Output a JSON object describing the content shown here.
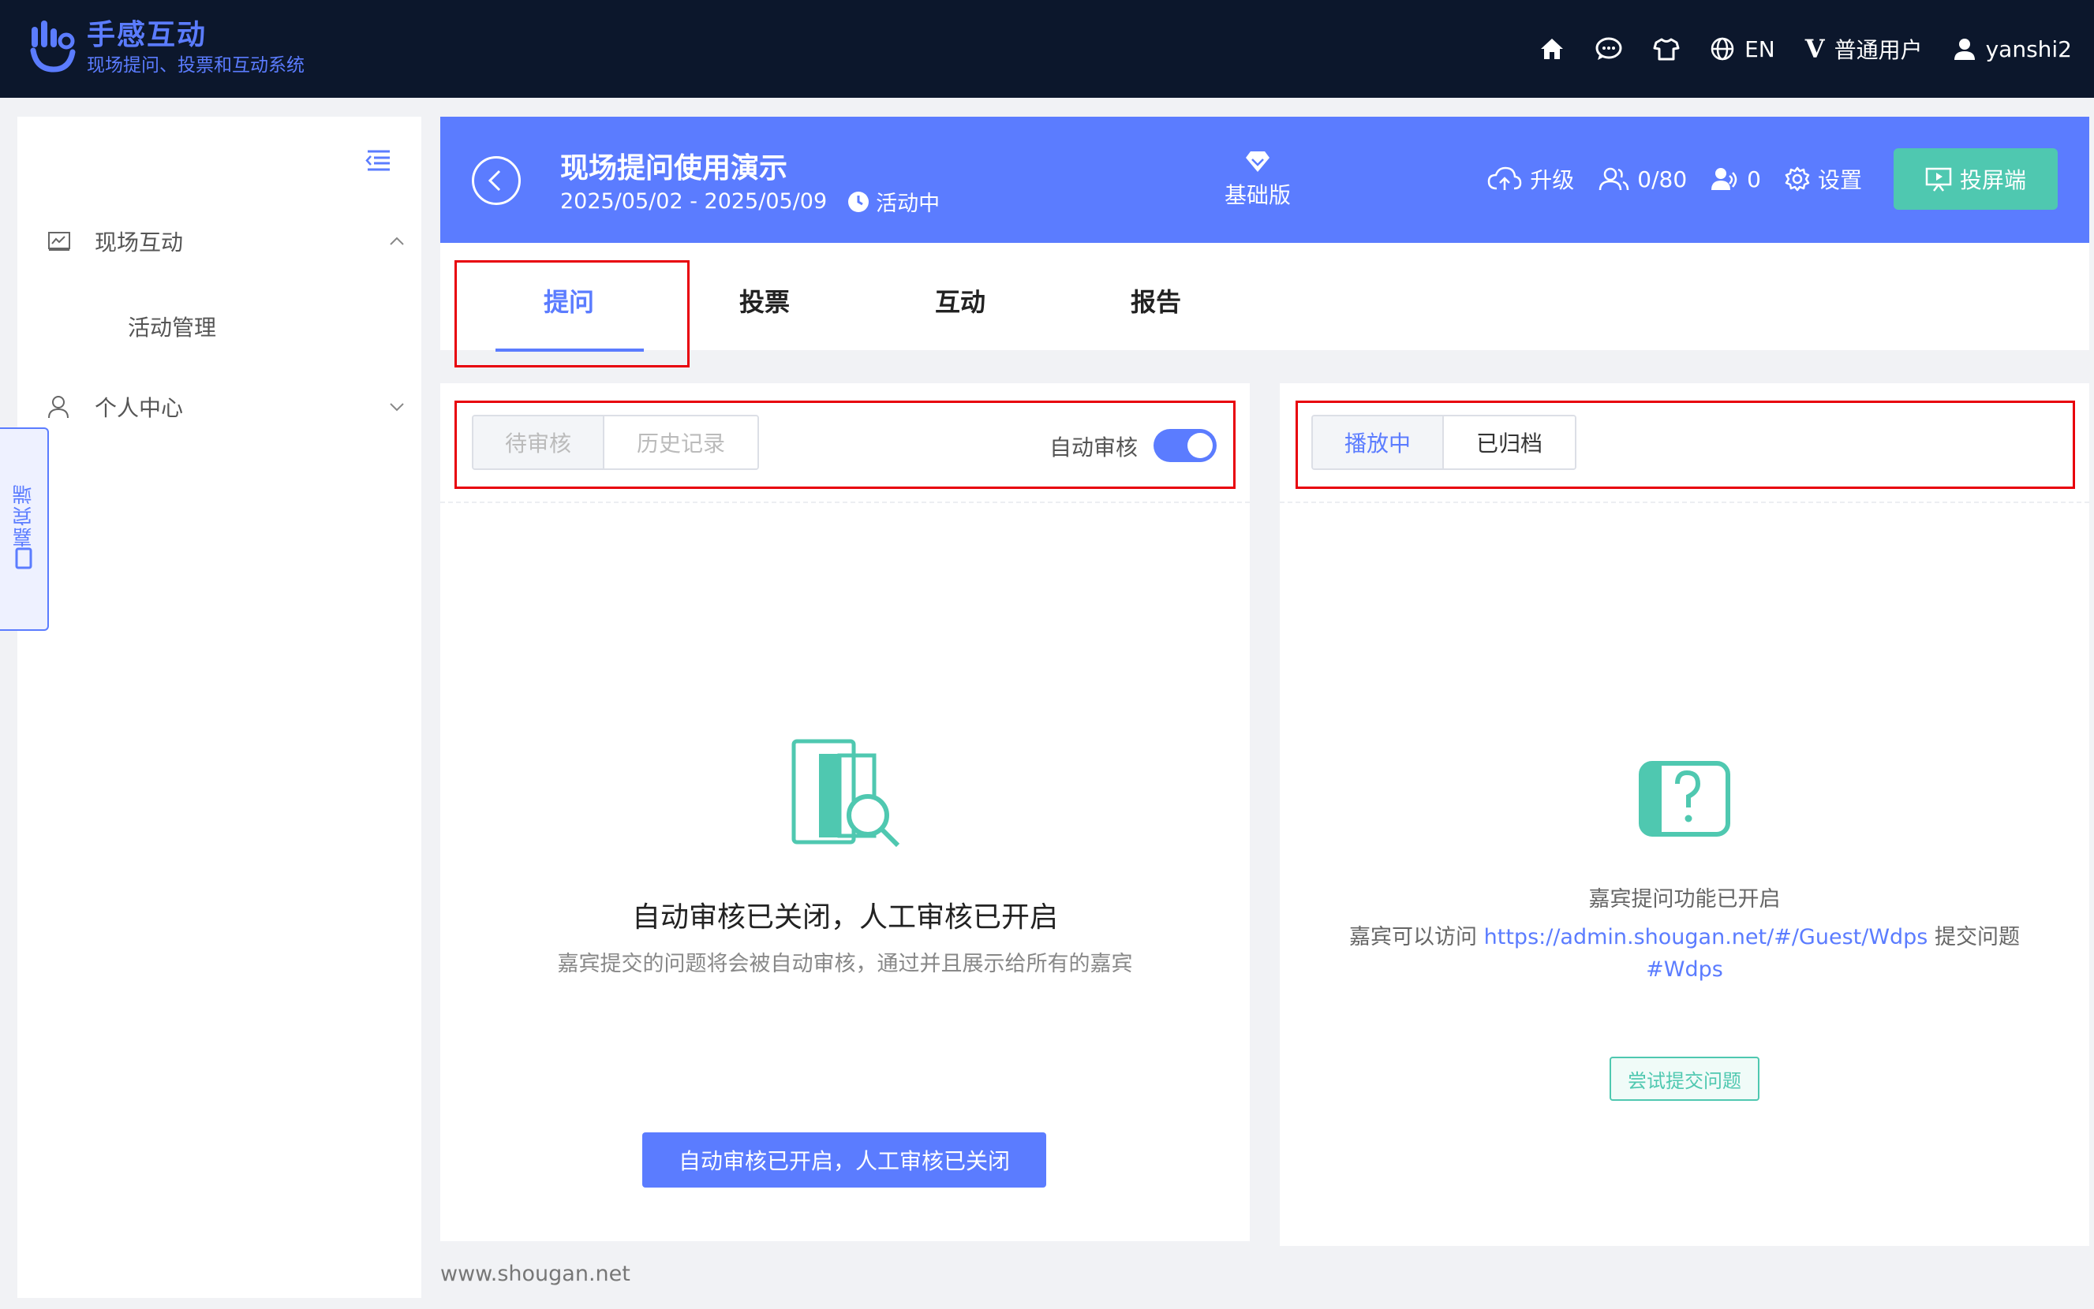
{
  "brand": {
    "title": "手感互动",
    "subtitle": "现场提问、投票和互动系统"
  },
  "topnav": {
    "language": "EN",
    "role": "普通用户",
    "role_mark": "V",
    "username": "yanshi2"
  },
  "sidebar": {
    "groups": [
      {
        "label": "现场互动",
        "children": [
          "活动管理"
        ]
      },
      {
        "label": "个人中心",
        "children": []
      }
    ],
    "guest_tab": "嘉宾端"
  },
  "activity": {
    "title": "现场提问使用演示",
    "date_range": "2025/05/02 - 2025/05/09",
    "status": "活动中",
    "plan": "基础版",
    "upgrade": "升级",
    "participants": "0/80",
    "online": "0",
    "settings": "设置",
    "projector": "投屏端"
  },
  "tabs": [
    "提问",
    "投票",
    "互动",
    "报告"
  ],
  "left_panel": {
    "seg": [
      "待审核",
      "历史记录"
    ],
    "auto_review_label": "自动审核",
    "auto_review_on": true,
    "empty_title": "自动审核已关闭，人工审核已开启",
    "empty_sub": "嘉宾提交的问题将会被自动审核，通过并且展示给所有的嘉宾",
    "action_button": "自动审核已开启，人工审核已关闭"
  },
  "right_panel": {
    "seg": [
      "播放中",
      "已归档"
    ],
    "line1": "嘉宾提问功能已开启",
    "line2_pre": "嘉宾可以访问",
    "url": "https://admin.shougan.net/#/Guest/Wdps",
    "line2_post": "提交问题",
    "code": "#Wdps",
    "try_button": "尝试提交问题"
  },
  "footer": "www.shougan.net",
  "colors": {
    "primary": "#5b7cff",
    "topbar": "#0c172c",
    "teal": "#4fc8b0",
    "highlight": "#e8000b"
  }
}
